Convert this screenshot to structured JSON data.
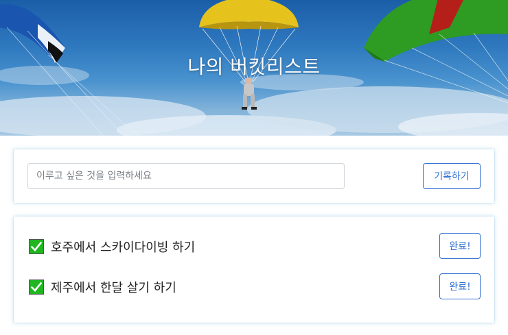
{
  "hero": {
    "title": "나의 버킷리스트"
  },
  "form": {
    "placeholder": "이루고 싶은 것을 입력하세요",
    "value": "",
    "submit_label": "기록하기"
  },
  "bucket_list": {
    "items": [
      {
        "text": "호주에서 스카이다이빙 하기",
        "done_label": "완료!",
        "icon": "check-mark-icon"
      },
      {
        "text": "제주에서 한달 살기 하기",
        "done_label": "완료!",
        "icon": "check-mark-icon"
      }
    ]
  },
  "colors": {
    "accent": "#2f6fcf",
    "check_bg": "#1fb61f",
    "card_shadow": "#50a0d2"
  }
}
